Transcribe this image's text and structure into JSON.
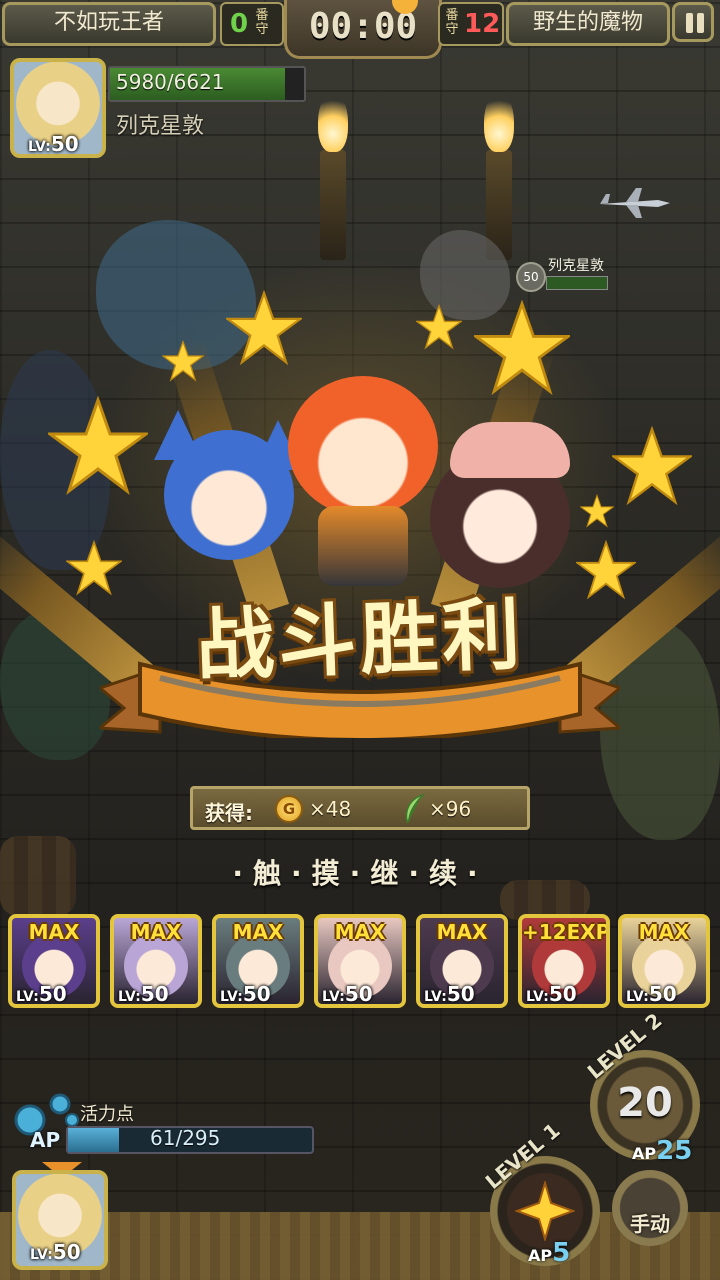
{
  "top_bar": {
    "player_name": "不如玩王者",
    "left_tickets": "0",
    "left_ticket_label": "番\n守",
    "timer": "00:00",
    "right_tickets": "12",
    "right_ticket_label": "番\n守",
    "stage_name": "野生的魔物"
  },
  "hero": {
    "level_prefix": "LV:",
    "level": "50",
    "hp_text": "5980/6621",
    "hp_fraction": 0.903,
    "name": "列克星敦"
  },
  "enemy_tag": {
    "level": "50",
    "name": "列克星敦"
  },
  "victory": {
    "title": "战斗胜利"
  },
  "reward": {
    "label": "获得:",
    "coin_icon_letter": "G",
    "coin_amount": "×48",
    "feather_amount": "×96"
  },
  "prompt": {
    "touch_continue": "·触·摸·继·续·"
  },
  "party": [
    {
      "badge": "MAX",
      "level_prefix": "LV:",
      "level": "50",
      "color": "#5b3f8c"
    },
    {
      "badge": "MAX",
      "level_prefix": "LV:",
      "level": "50",
      "color": "#b9a6d6"
    },
    {
      "badge": "MAX",
      "level_prefix": "LV:",
      "level": "50",
      "color": "#6a7d7e"
    },
    {
      "badge": "MAX",
      "level_prefix": "LV:",
      "level": "50",
      "color": "#e8c8c0"
    },
    {
      "badge": "MAX",
      "level_prefix": "LV:",
      "level": "50",
      "color": "#4d3a4e"
    },
    {
      "badge": "+12EXP",
      "level_prefix": "LV:",
      "level": "50",
      "color": "#b03a3a"
    },
    {
      "badge": "MAX",
      "level_prefix": "LV:",
      "level": "50",
      "color": "#e9d39a"
    }
  ],
  "ap": {
    "label": "活力点",
    "badge": "AP",
    "text": "61/295",
    "fraction": 0.207
  },
  "bottom_portrait": {
    "level_prefix": "LV:",
    "level": "50"
  },
  "skills": {
    "skill2": {
      "level_label": "LEVEL 2",
      "value": "20",
      "ap_label": "AP",
      "ap_cost": "25"
    },
    "skill1": {
      "level_label": "LEVEL 1",
      "ap_label": "AP",
      "ap_cost": "5"
    },
    "manual_label": "手动"
  },
  "colors": {
    "gold_border": "#e3c63e",
    "hp_green": "#4a8a34",
    "ap_blue": "#5ab0d8",
    "banner_orange": "#e7922a"
  }
}
